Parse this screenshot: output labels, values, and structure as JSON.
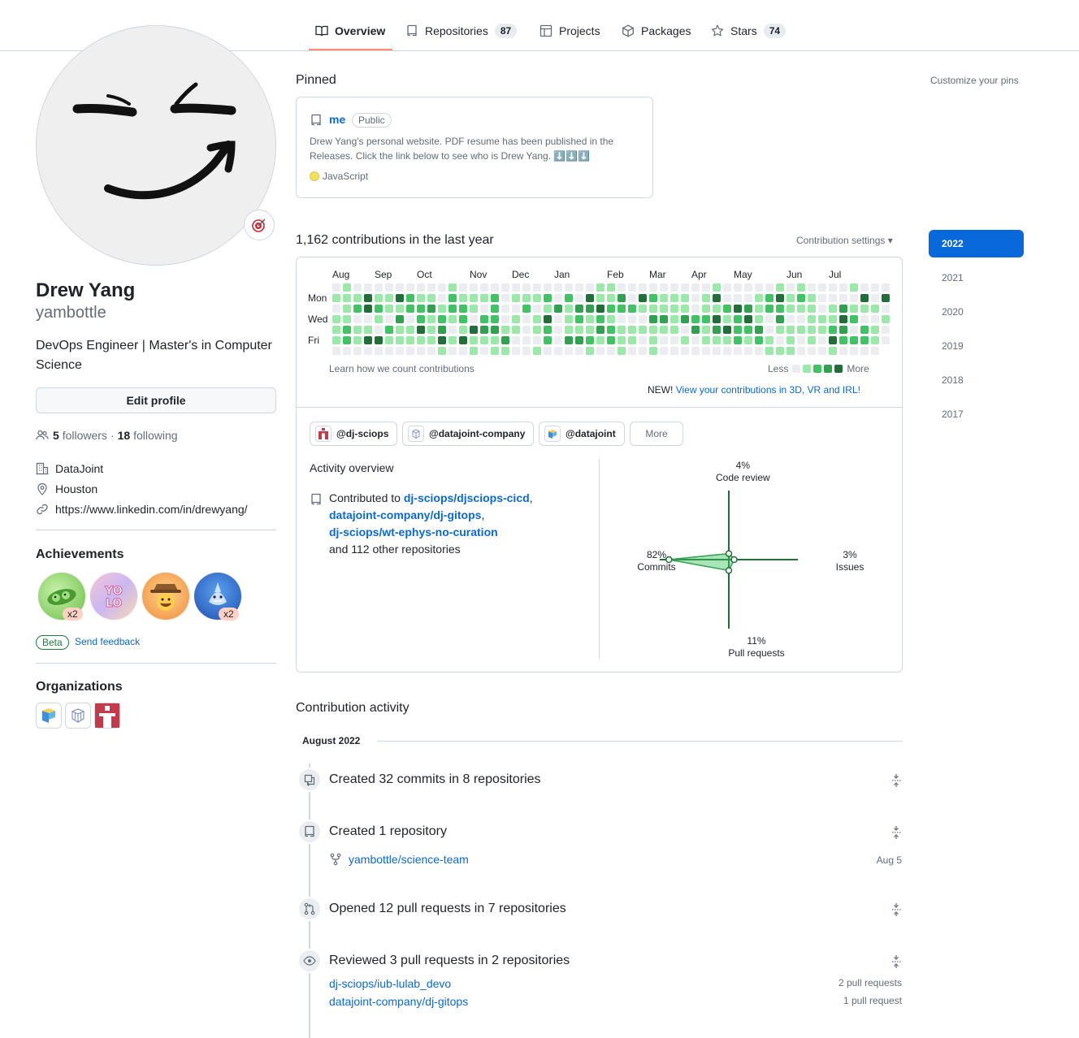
{
  "nav": {
    "tabs": [
      {
        "label": "Overview",
        "icon": "book-icon"
      },
      {
        "label": "Repositories",
        "icon": "repo-icon",
        "count": "87"
      },
      {
        "label": "Projects",
        "icon": "table-icon"
      },
      {
        "label": "Packages",
        "icon": "package-icon"
      },
      {
        "label": "Stars",
        "icon": "star-icon",
        "count": "74"
      }
    ],
    "active_tab": "Overview",
    "accent": "#fd8c73"
  },
  "profile": {
    "name": "Drew Yang",
    "login": "yambottle",
    "bio": "DevOps Engineer | Master's in Computer Science",
    "edit_label": "Edit profile",
    "followers_count": "5",
    "followers_label": "followers",
    "separator": "·",
    "following_count": "18",
    "following_label": "following",
    "company": "DataJoint",
    "location": "Houston",
    "website": "https://www.linkedin.com/in/drewyang/",
    "status_icon": "target-icon"
  },
  "achievements": {
    "title": "Achievements",
    "badges": [
      {
        "name": "pair-extraordinaire",
        "tier": "x2"
      },
      {
        "name": "yolo",
        "tier": ""
      },
      {
        "name": "quickdraw",
        "tier": ""
      },
      {
        "name": "pull-shark",
        "tier": "x2"
      }
    ],
    "beta_label": "Beta",
    "feedback_label": "Send feedback"
  },
  "organizations": {
    "title": "Organizations",
    "items": [
      "datajoint",
      "datajoint-company",
      "dj-sciops"
    ]
  },
  "pinned": {
    "title": "Pinned",
    "customize_label": "Customize your pins",
    "repo": {
      "name": "me",
      "visibility": "Public",
      "description": "Drew Yang's personal website. PDF resume has been published in the Releases. Click the link below to see who is Drew Yang. ⬇️⬇️⬇️",
      "language": "JavaScript",
      "language_color": "#f1e05a"
    }
  },
  "contributions": {
    "title": "1,162 contributions in the last year",
    "settings_label": "Contribution settings ▾",
    "months": [
      "Aug",
      "Sep",
      "Oct",
      "Nov",
      "Dec",
      "Jan",
      "Feb",
      "Mar",
      "Apr",
      "May",
      "Jun",
      "Jul"
    ],
    "weekdays": [
      "Mon",
      "Wed",
      "Fri"
    ],
    "learn_label": "Learn how we count contributions",
    "less_label": "Less",
    "more_label": "More",
    "levels": [
      "#ebedf0",
      "#9be9a8",
      "#40c463",
      "#30a14e",
      "#216e39"
    ],
    "new_prefix": "NEW!",
    "new_link": "View your contributions in 3D, VR and IRL!"
  },
  "activity_overview": {
    "orgs": [
      "@dj-sciops",
      "@datajoint-company",
      "@datajoint"
    ],
    "more_label": "More",
    "title": "Activity overview",
    "contributed_prefix": "Contributed to",
    "repos": [
      "dj-sciops/djsciops-cicd",
      "datajoint-company/dj-gitops",
      "dj-sciops/wt-ephys-no-curation"
    ],
    "other": "and 112 other repositories",
    "commits_pct": 82,
    "code_review_pct": 4,
    "issues_pct": 3,
    "pull_requests_pct": 11,
    "commits_text": "82%",
    "commits_label": "Commits",
    "code_review_text": "4%",
    "code_review_label": "Code review",
    "issues_text": "3%",
    "issues_label": "Issues",
    "pr_text": "11%",
    "pr_label": "Pull requests"
  },
  "contribution_activity": {
    "title": "Contribution activity",
    "month": "August 2022",
    "events": [
      {
        "icon": "commit-icon",
        "title": "Created 32 commits in 8 repositories"
      },
      {
        "icon": "repo-icon",
        "title": "Created 1 repository",
        "repo": "yambottle/science-team",
        "date": "Aug 5"
      },
      {
        "icon": "pull-request-icon",
        "title": "Opened 12 pull requests in 7 repositories"
      },
      {
        "icon": "eye-icon",
        "title": "Reviewed 3 pull requests in 2 repositories",
        "items": [
          {
            "repo": "dj-sciops/iub-lulab_devo",
            "count": "2 pull requests"
          },
          {
            "repo": "datajoint-company/dj-gitops",
            "count": "1 pull request"
          }
        ]
      }
    ]
  },
  "years": [
    "2022",
    "2021",
    "2020",
    "2019",
    "2018",
    "2017"
  ],
  "active_year": "2022"
}
